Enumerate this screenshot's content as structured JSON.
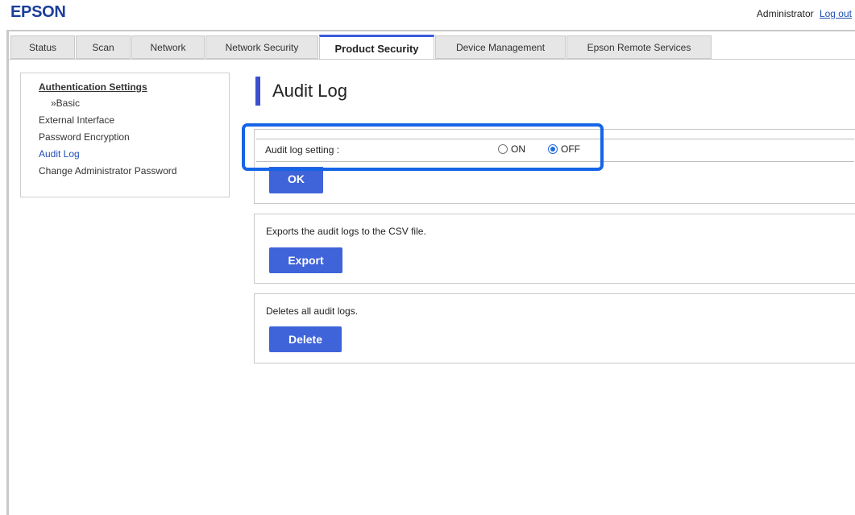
{
  "header": {
    "logo": "EPSON",
    "user_label": "Administrator",
    "logout_label": "Log out"
  },
  "tabs": [
    {
      "label": "Status"
    },
    {
      "label": "Scan"
    },
    {
      "label": "Network"
    },
    {
      "label": "Network Security"
    },
    {
      "label": "Product Security",
      "active": true
    },
    {
      "label": "Device Management"
    },
    {
      "label": "Epson Remote Services"
    }
  ],
  "sidebar": {
    "section_title": "Authentication Settings",
    "sub_item": "»Basic",
    "items": [
      {
        "label": "External Interface"
      },
      {
        "label": "Password Encryption"
      },
      {
        "label": "Audit Log",
        "active": true
      },
      {
        "label": "Change Administrator Password"
      }
    ]
  },
  "page": {
    "title": "Audit Log"
  },
  "audit_setting": {
    "label": "Audit log setting :",
    "on_label": "ON",
    "off_label": "OFF",
    "selected": "OFF",
    "ok_label": "OK"
  },
  "export_panel": {
    "text": "Exports the audit logs to the CSV file.",
    "button": "Export"
  },
  "delete_panel": {
    "text": "Deletes all audit logs.",
    "button": "Delete"
  },
  "colors": {
    "brand": "#1a3f9a",
    "button": "#3f63d9",
    "highlight": "#1565e6",
    "active_tab_accent": "#3b5bdb"
  }
}
